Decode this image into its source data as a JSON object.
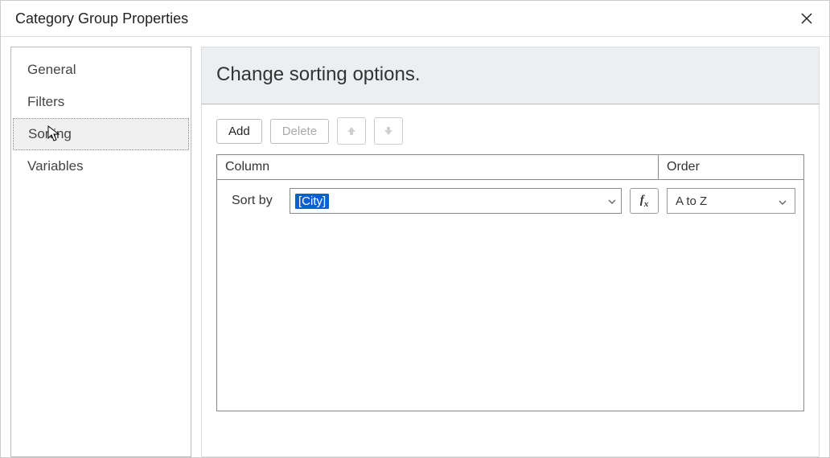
{
  "title": "Category Group Properties",
  "sidebar": {
    "items": [
      {
        "label": "General"
      },
      {
        "label": "Filters"
      },
      {
        "label": "Sorting"
      },
      {
        "label": "Variables"
      }
    ],
    "selected_index": 2
  },
  "main": {
    "heading": "Change sorting options.",
    "toolbar": {
      "add_label": "Add",
      "delete_label": "Delete"
    },
    "grid": {
      "col_column_label": "Column",
      "col_order_label": "Order",
      "row": {
        "sort_by_label": "Sort by",
        "column_value": "[City]",
        "fx_label": "fx",
        "order_value": "A to Z"
      }
    }
  }
}
